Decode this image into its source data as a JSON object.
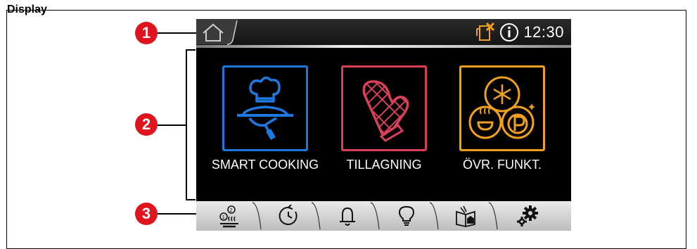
{
  "header_cutoff_text": "Display",
  "status_bar": {
    "time": "12:30",
    "icons": [
      "home-icon",
      "cleaning-alert-icon",
      "info-icon"
    ],
    "alert_color": "#f0a020"
  },
  "tiles": [
    {
      "label": "SMART COOKING",
      "icon": "chef-serving-icon",
      "color": "#1f78e0"
    },
    {
      "label": "TILLAGNING",
      "icon": "oven-mitt-icon",
      "color": "#d8405a"
    },
    {
      "label": "ÖVR. FUNKT.",
      "icon": "other-functions-icon",
      "color": "#f0a020"
    }
  ],
  "tab_bar": {
    "tabs": [
      "multi-level-cooking-icon",
      "timer-icon",
      "bell-icon",
      "lightbulb-icon",
      "recipe-book-icon",
      "settings-gears-icon"
    ]
  },
  "callouts": {
    "marker_1": "1",
    "marker_2": "2",
    "marker_3": "3"
  },
  "colors": {
    "marker": "#e0141e",
    "screen_background": "#000000"
  }
}
